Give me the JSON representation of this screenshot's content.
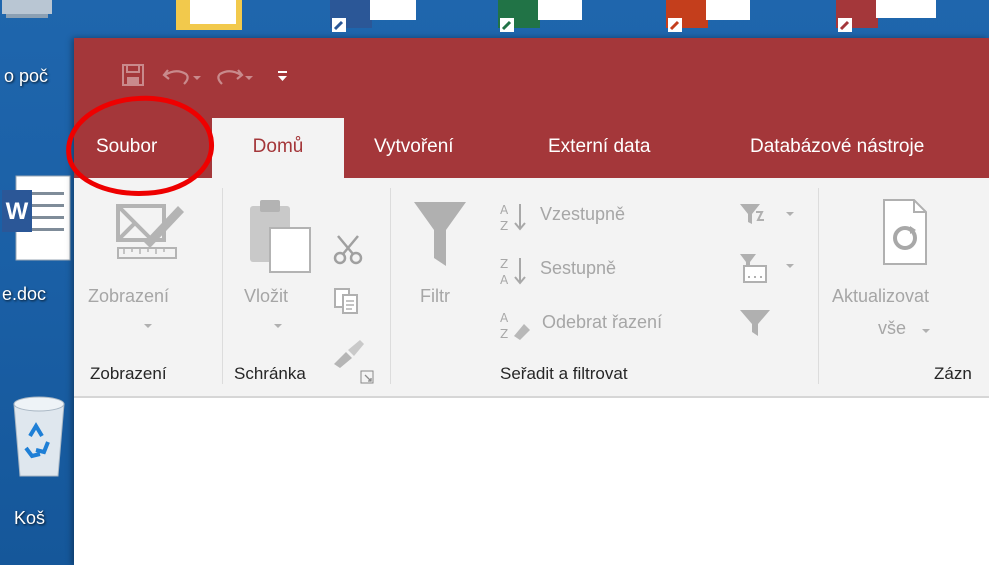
{
  "desktop": {
    "labels": {
      "computer": "o poč",
      "document": "e.doc",
      "recycle_bin": "Koš"
    }
  },
  "app": {
    "tabs": [
      "Soubor",
      "Domů",
      "Vytvoření",
      "Externí data",
      "Databázové nástroje"
    ],
    "active_tab": "Domů"
  },
  "ribbon": {
    "views": {
      "button": "Zobrazení",
      "group": "Zobrazení"
    },
    "clipboard": {
      "paste": "Vložit",
      "group": "Schránka"
    },
    "sort_filter": {
      "filter": "Filtr",
      "ascending": "Vzestupně",
      "descending": "Sestupně",
      "remove_sort": "Odebrat řazení",
      "group": "Seřadit a filtrovat"
    },
    "records": {
      "refresh_line1": "Aktualizovat",
      "refresh_line2": "vše",
      "group": "Zázn"
    }
  },
  "colors": {
    "accent": "#a4373a",
    "annotation": "#ee0000"
  }
}
